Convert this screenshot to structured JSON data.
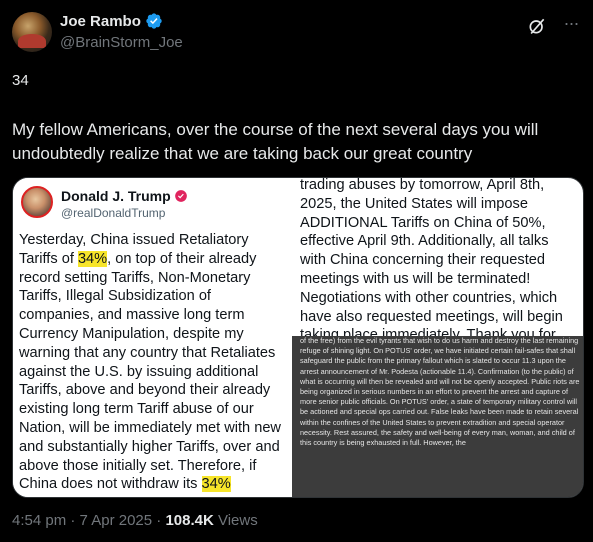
{
  "author": {
    "display_name": "Joe Rambo",
    "handle": "@BrainStorm_Joe"
  },
  "post": {
    "line1": "34",
    "body": "My fellow Americans, over the course of the next several days you will undoubtedly realize that we are taking back our great country"
  },
  "embedded_left": {
    "display_name": "Donald J. Trump",
    "handle": "@realDonaldTrump",
    "text_parts": [
      "Yesterday, China issued Retaliatory Tariffs of ",
      "34%",
      ", on top of their already record setting Tariffs, Non-Monetary Tariffs, Illegal Subsidization of companies, and massive long term Currency Manipulation, despite my warning that any country that Retaliates against the U.S. by issuing additional Tariffs, above and beyond their already existing long term Tariff abuse of our Nation, will be immediately met with new and substantially higher Tariffs, over and above those initially set. Therefore, if China does not withdraw its ",
      "34%"
    ]
  },
  "embedded_right_top": {
    "text": "trading abuses by tomorrow, April 8th, 2025, the United States will impose ADDITIONAL Tariffs on China of 50%, effective April 9th. Additionally, all talks with China concerning their requested meetings with us will be terminated! Negotiations with other countries, which have also requested meetings, will begin taking place immediately. Thank you for your attention to this matter!"
  },
  "embedded_right_bottom": {
    "text": "of the free) from the evil tyrants that wish to do us harm and destroy the last remaining refuge of shining light. On POTUS' order, we have initiated certain fail-safes that shall safeguard the public from the primary fallout which is slated to occur 11.3 upon the arrest announcement of Mr. Podesta (actionable 11.4). Confirmation (to the public) of what is occurring will then be revealed and will not be openly accepted. Public riots are being organized in serious numbers in an effort to prevent the arrest and capture of more senior public officials. On POTUS' order, a state of temporary military control will be actioned and special ops carried out. False leaks have been made to retain several within the confines of the United States to prevent extradition and special operator necessity. Rest assured, the safety and well-being of every man, woman, and child of this country is being exhausted in full. However, the"
  },
  "footer": {
    "time": "4:54 pm",
    "sep": " · ",
    "date": "7 Apr 2025",
    "views_count": "108.4K",
    "views_label": " Views"
  },
  "icons": {
    "verified": "verified-badge-icon",
    "grok": "grok-icon",
    "more": "more-icon"
  },
  "colors": {
    "background": "#000000",
    "text": "#e7e9ea",
    "muted": "#71767b",
    "verified": "#1d9bf0",
    "highlight": "#f7e52a"
  }
}
